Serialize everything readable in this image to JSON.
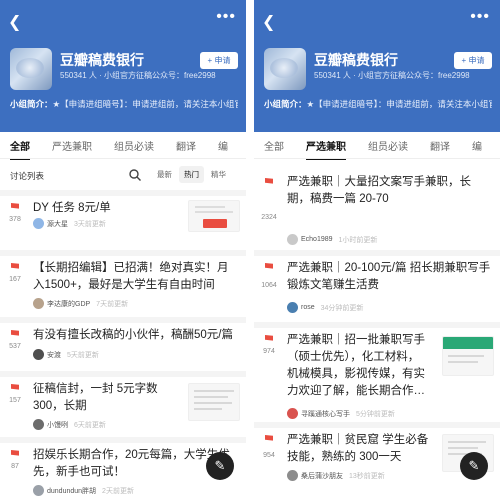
{
  "left": {
    "group_name": "豆瓣稿费银行",
    "group_meta": "550341 人 · 小组官方征稿公众号：free2998",
    "apply_label": "+ 申请",
    "intro_label": "小组简介：",
    "intro_text": "★【申请进组暗号】：申请进组前，请关注本小组官方征稿平台微信公众号：丁小云（free29…",
    "tabs": [
      "全部",
      "严选兼职",
      "组员必读",
      "翻译",
      "编"
    ],
    "active_tab": 0,
    "list_title": "讨论列表",
    "sorts": [
      "最新",
      "热门",
      "精华"
    ],
    "active_sort": 1,
    "items": [
      {
        "votes": "378",
        "title": "DY 任务 8元/单",
        "author": "源大星",
        "time": "3天前更新",
        "avatar_color": "#8fb6e6"
      },
      {
        "votes": "167",
        "title": "【长期招编辑】已招满！绝对真实！月入1500+，最好是大学生有自由时间",
        "author": "李达康的GDP",
        "time": "7天前更新",
        "avatar_color": "#b7a28c"
      },
      {
        "votes": "537",
        "title": "有没有擅长改稿的小伙伴，稿酬50元/篇",
        "author": "安渡",
        "time": "5天前更新",
        "avatar_color": "#4f4f4f"
      },
      {
        "votes": "157",
        "title": "征稿信封，一封 5元字数 300，长期",
        "author": "小馒咧",
        "time": "6天前更新",
        "avatar_color": "#6c6c6c"
      },
      {
        "votes": "87",
        "title": "招娱乐长期合作，20元每篇，大学生优先，新手也可试！",
        "author": "dundundun胖胡",
        "time": "2天前更新",
        "avatar_color": "#9aa0a8"
      }
    ],
    "fab_icon": "edit-icon"
  },
  "right": {
    "group_name": "豆瓣稿费银行",
    "group_meta": "550341 人 · 小组官方征稿公众号：free2998",
    "apply_label": "+ 申请",
    "intro_label": "小组简介：",
    "intro_text": "★【申请进组暗号】：申请进组前，请关注本小组官方征稿平台微信公众号：丁小云（free29…",
    "tabs": [
      "全部",
      "严选兼职",
      "组员必读",
      "翻译",
      "编"
    ],
    "active_tab": 1,
    "items": [
      {
        "votes": "2324",
        "title": "严选兼职｜大量招文案写手兼职，长期，稿费一篇 20-70",
        "author": "Echo1989",
        "time": "1小时前更新",
        "avatar_color": "#c9c9c9"
      },
      {
        "votes": "1064",
        "title": "严选兼职｜20-100元/篇 招长期兼职写手 锻炼文笔赚生活费",
        "author": "rose",
        "time": "34分钟前更新",
        "avatar_color": "#4a7fb0"
      },
      {
        "votes": "974",
        "title": "严选兼职｜招一批兼职写手（硕士优先），化工材料，机械模具，影视传媒，有实力欢迎了解，能长期合作…",
        "author": "寻蹊通核心写手",
        "time": "5分钟前更新",
        "avatar_color": "#d9534f"
      },
      {
        "votes": "954",
        "title": "严选兼职｜贫民窟 学生必备技能，熟练的 300一天",
        "author": "桑后蒲沙朋友",
        "time": "13秒前更新",
        "avatar_color": "#8c8c8c"
      }
    ],
    "fab_icon": "edit-icon"
  },
  "colors": {
    "header_bg": "#3d6fc0",
    "flag": "#e94d40",
    "fab": "#222222"
  }
}
